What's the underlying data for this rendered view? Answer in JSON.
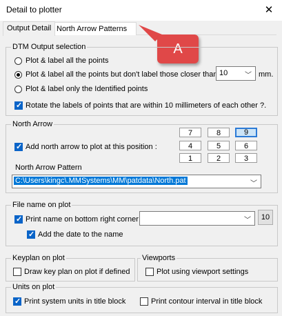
{
  "window": {
    "title": "Detail to plotter",
    "close_glyph": "✕"
  },
  "tabs": [
    {
      "label": "Output Detail"
    },
    {
      "label": "North Arrow Patterns"
    }
  ],
  "dtm": {
    "legend": "DTM Output selection",
    "options": [
      {
        "label": "Plot & label all the points",
        "selected": false
      },
      {
        "label": "Plot & label all the points but don't label those closer than",
        "selected": true
      },
      {
        "label": "Plot & label only the Identified points",
        "selected": false
      }
    ],
    "distance_value": "10",
    "distance_unit": "mm.",
    "rotate_label": "Rotate the labels of points that are within 10 millimeters of each other ?.",
    "rotate_checked": true
  },
  "north_arrow": {
    "legend": "North Arrow",
    "add_label": "Add north arrow to plot at this position :",
    "add_checked": true,
    "positions": [
      "7",
      "8",
      "9",
      "4",
      "5",
      "6",
      "1",
      "2",
      "3"
    ],
    "selected_position": "9",
    "pattern_label": "North Arrow Pattern",
    "pattern_value": "C:\\Users\\kingc\\.MMSystems\\MM\\patdata\\North.pat"
  },
  "file_name": {
    "legend": "File name on plot",
    "print_label": "Print name on bottom right corner",
    "print_checked": true,
    "font_size": "10",
    "date_label": "Add the date to the name",
    "date_checked": true
  },
  "keyplan": {
    "legend": "Keyplan on plot",
    "draw_label": "Draw key plan on plot if defined",
    "draw_checked": false
  },
  "viewports": {
    "legend": "Viewports",
    "plot_label": "Plot using viewport settings",
    "plot_checked": false
  },
  "units": {
    "legend": "Units on plot",
    "system_label": "Print system units in title block",
    "system_checked": true,
    "contour_label": "Print contour interval in title block",
    "contour_checked": false
  },
  "annotation": {
    "marker_text": "A",
    "color": "#e04848"
  }
}
